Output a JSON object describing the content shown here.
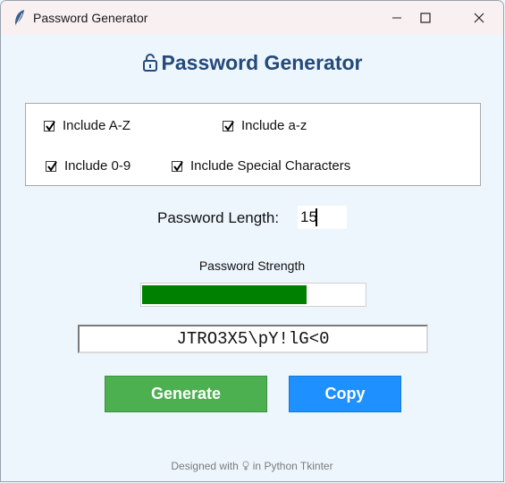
{
  "window": {
    "title": "Password Generator"
  },
  "header": {
    "title": "Password Generator"
  },
  "options": [
    {
      "label": "Include A-Z",
      "checked": true
    },
    {
      "label": "Include a-z",
      "checked": true
    },
    {
      "label": "Include 0-9",
      "checked": true
    },
    {
      "label": "Include Special Characters",
      "checked": true
    }
  ],
  "length": {
    "label": "Password Length:",
    "value": "15"
  },
  "strength": {
    "label": "Password Strength",
    "level": 0.74,
    "color": "#008000"
  },
  "password": {
    "value": "JTRO3X5\\pY!lG<0"
  },
  "buttons": {
    "generate": "Generate",
    "copy": "Copy",
    "generate_color": "#4caf50",
    "copy_color": "#1e90ff"
  },
  "footer": {
    "before": "Designed with",
    "after": "in Python Tkinter"
  }
}
